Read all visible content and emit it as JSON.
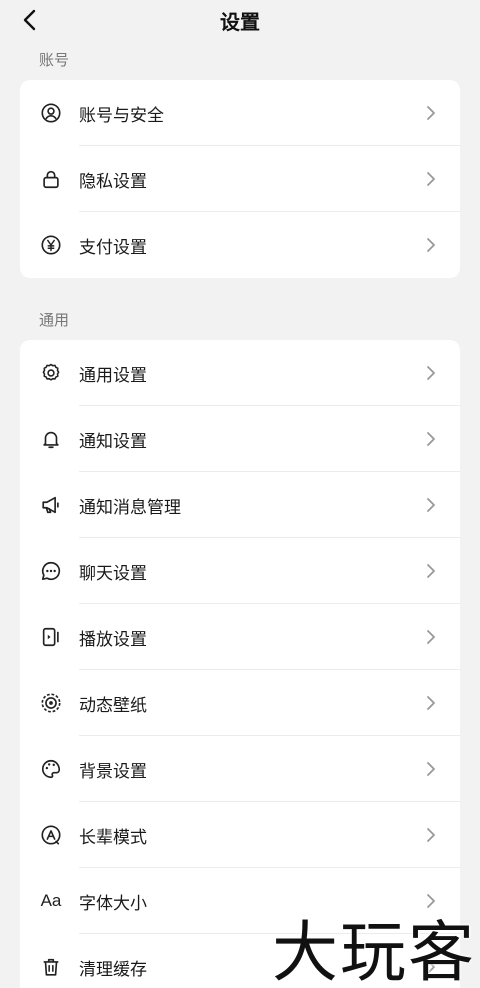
{
  "header": {
    "title": "设置"
  },
  "sections": {
    "account": {
      "label": "账号",
      "items": [
        {
          "label": "账号与安全",
          "icon": "user-circle-icon"
        },
        {
          "label": "隐私设置",
          "icon": "lock-icon"
        },
        {
          "label": "支付设置",
          "icon": "yen-icon"
        }
      ]
    },
    "general": {
      "label": "通用",
      "items": [
        {
          "label": "通用设置",
          "icon": "gear-icon"
        },
        {
          "label": "通知设置",
          "icon": "bell-icon"
        },
        {
          "label": "通知消息管理",
          "icon": "megaphone-icon"
        },
        {
          "label": "聊天设置",
          "icon": "chat-bubble-icon"
        },
        {
          "label": "播放设置",
          "icon": "play-panel-icon"
        },
        {
          "label": "动态壁纸",
          "icon": "live-wallpaper-icon"
        },
        {
          "label": "背景设置",
          "icon": "palette-icon"
        },
        {
          "label": "长辈模式",
          "icon": "elder-mode-icon"
        },
        {
          "label": "字体大小",
          "icon": "font-size-icon",
          "glyph": "Aa"
        },
        {
          "label": "清理缓存",
          "icon": "trash-icon"
        }
      ]
    }
  },
  "watermark": {
    "text": "大玩客"
  }
}
